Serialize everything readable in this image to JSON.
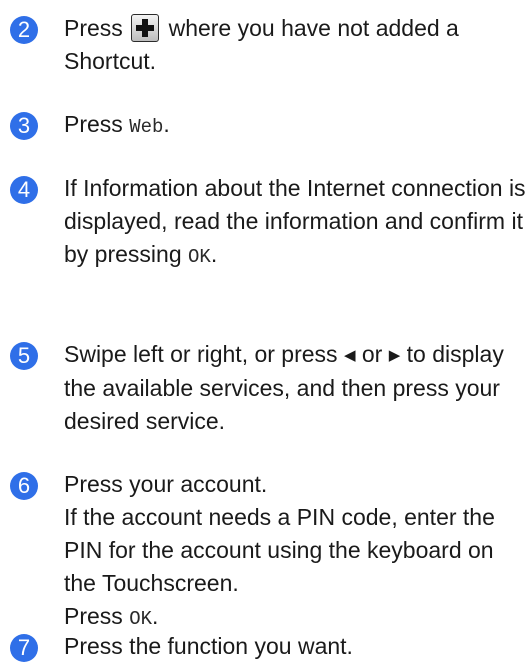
{
  "colors": {
    "badge": "#2f6fe8",
    "text": "#1a1a1a"
  },
  "steps": [
    {
      "number": "2",
      "text_before": "Press",
      "icon": "plus-icon",
      "text_after": "where you have not added a Shortcut."
    },
    {
      "number": "3",
      "text_before": "Press",
      "code": "Web",
      "text_after": "."
    },
    {
      "number": "4",
      "text": "If Information about the Internet connection is displayed, read the information and confirm it by pressing",
      "code": "OK",
      "text_after": "."
    },
    {
      "number": "5",
      "text_before": "Swipe left or right, or press",
      "left_icon": "◀",
      "text_mid": "or",
      "right_icon": "▶",
      "text_after": "to display the available services, and then press your desired service."
    },
    {
      "number": "6",
      "line1": "Press your account.",
      "line2": "If the account needs a PIN code, enter the PIN for the account using the keyboard on the Touchscreen.",
      "line3_before": "Press",
      "code": "OK",
      "line3_after": "."
    },
    {
      "number": "7",
      "text": "Press the function you want."
    }
  ]
}
